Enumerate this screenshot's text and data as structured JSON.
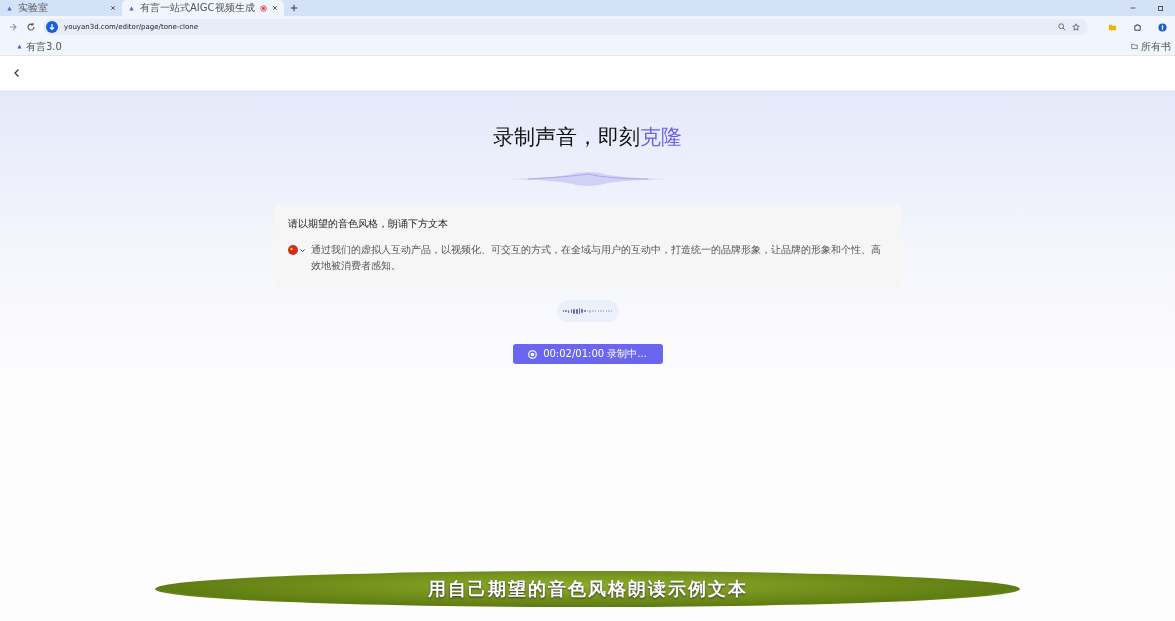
{
  "browser": {
    "tabs": [
      {
        "title": "实验室",
        "selected": false
      },
      {
        "title": "有言一站式AIGC视频生成",
        "selected": true,
        "recording": true
      }
    ],
    "url": "youyan3d.com/editor/page/tone-clone",
    "bookmarks": [
      "有言3.0"
    ],
    "bookmarks_right": "所有书"
  },
  "page": {
    "title": "录制声音，即刻",
    "title_highlight": "克隆",
    "prompt": "请以期望的音色风格，朗诵下方文本",
    "script_text": "通过我们的虚拟人互动产品，以视频化、可交互的方式，在全域与用户的互动中，打造统一的品牌形象，让品牌的形象和个性、高效地被消费者感知。",
    "record_button": "00:02/01:00 录制中..."
  },
  "caption": "用自己期望的音色风格朗读示例文本"
}
